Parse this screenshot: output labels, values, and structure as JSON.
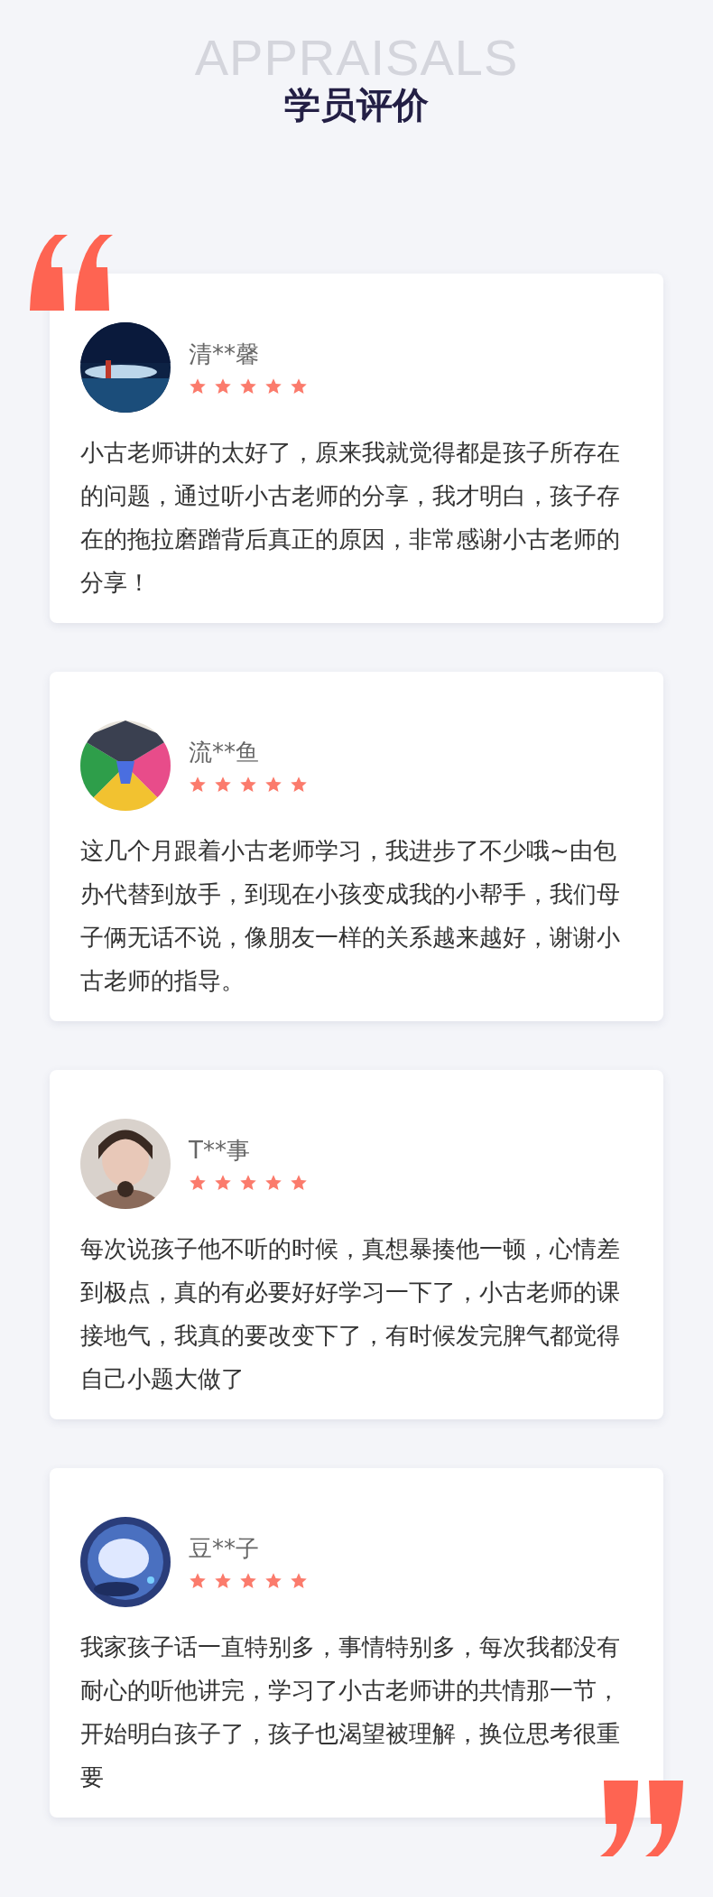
{
  "header": {
    "subtitle_en": "APPRAISALS",
    "title": "学员评价"
  },
  "reviews": [
    {
      "name": "清**馨",
      "stars": 5,
      "text": "小古老师讲的太好了，原来我就觉得都是孩子所存在的问题，通过听小古老师的分享，我才明白，孩子存在的拖拉磨蹭背后真正的原因，非常感谢小古老师的分享！"
    },
    {
      "name": "流**鱼",
      "stars": 5,
      "text": "这几个月跟着小古老师学习，我进步了不少哦~由包办代替到放手，到现在小孩变成我的小帮手，我们母子俩无话不说，像朋友一样的关系越来越好，谢谢小古老师的指导。"
    },
    {
      "name": "T**事",
      "stars": 5,
      "text": "每次说孩子他不听的时候，真想暴揍他一顿，心情差到极点，真的有必要好好学习一下了，小古老师的课接地气，我真的要改变下了，有时候发完脾气都觉得自己小题大做了"
    },
    {
      "name": "豆**子",
      "stars": 5,
      "text": "我家孩子话一直特别多，事情特别多，每次我都没有耐心的听他讲完，学习了小古老师讲的共情那一节，开始明白孩子了，孩子也渴望被理解，换位思考很重要"
    }
  ]
}
